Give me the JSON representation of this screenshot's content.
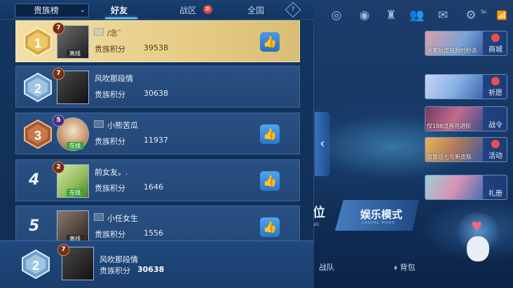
{
  "header": {
    "select": {
      "value": "贵族榜"
    },
    "tabs": [
      {
        "label": "好友",
        "active": true
      },
      {
        "label": "战区",
        "active": false,
        "badge": "新"
      },
      {
        "label": "全国",
        "active": false
      }
    ],
    "help": "?"
  },
  "rows": [
    {
      "rank": "1",
      "level": "7",
      "name": "/念˘",
      "score_label": "贵族积分",
      "score": "39538",
      "status": "离线",
      "like": true
    },
    {
      "rank": "2",
      "level": "7",
      "name": "风吹那段情",
      "score_label": "贵族积分",
      "score": "30638",
      "status": "",
      "like": false
    },
    {
      "rank": "3",
      "level": "5",
      "name": "小熊苦瓜",
      "score_label": "贵族积分",
      "score": "11937",
      "status": "在线",
      "like": true
    },
    {
      "rank": "4",
      "level": "2",
      "name": "前女友。.",
      "score_label": "贵族积分",
      "score": "1646",
      "status": "在线",
      "like": true
    },
    {
      "rank": "5",
      "level": "",
      "name": "小任女生",
      "score_label": "贵族积分",
      "score": "1556",
      "status": "离线",
      "like": true
    }
  ],
  "self": {
    "rank": "2",
    "level": "7",
    "name": "风吹那段情",
    "score_label": "贵族积分",
    "score": "30638"
  },
  "side_panel": {
    "shop_cards": [
      {
        "caption": "米莱狄皮肤限时秒杀",
        "side": "商城"
      },
      {
        "caption": "",
        "side": "祈愿"
      },
      {
        "caption": "仅188点券可进阶",
        "side": "战令"
      },
      {
        "caption": "狼鲁班七号新皮肤",
        "side": "活动"
      },
      {
        "caption": "",
        "side": "礼册"
      }
    ],
    "mode_button": {
      "label": "娱乐模式",
      "sub": "CASUAL MODE"
    },
    "rank_partial": {
      "label": "位",
      "sub": "NG"
    },
    "bottom": [
      "战队",
      "背包"
    ],
    "top_text": "Tai"
  },
  "colors": {
    "first_row": "#e6cc86",
    "like": "#3a8ee0",
    "online": "#3aa53c",
    "panel": "#143660"
  }
}
